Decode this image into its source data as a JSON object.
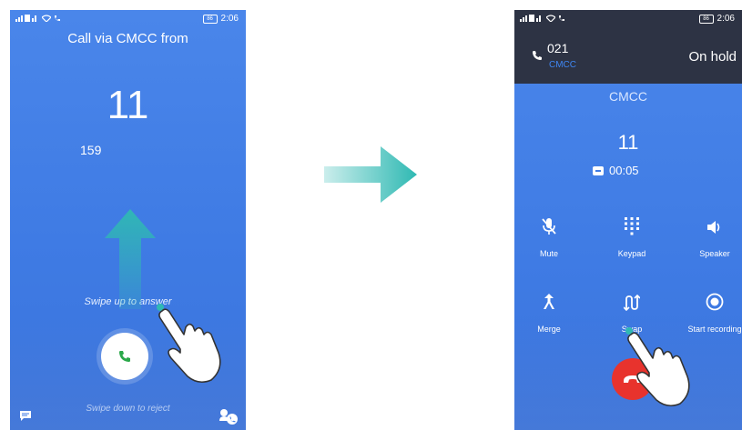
{
  "incoming_screen": {
    "status_time": "2:06",
    "battery": "86",
    "call_via": "Call via CMCC from",
    "number_big": "11",
    "number_small": "159",
    "swipe_up_hint": "Swipe up to answer",
    "swipe_down_hint": "Swipe down to reject"
  },
  "in_call_screen": {
    "status_time": "2:06",
    "battery": "86",
    "hold_number": "021",
    "hold_name": "CMCC",
    "hold_status": "On hold",
    "caller_name": "CMCC",
    "number": "11",
    "duration": "00:05",
    "controls": {
      "mute": "Mute",
      "keypad": "Keypad",
      "speaker": "Speaker",
      "merge": "Merge",
      "swap": "Swap",
      "record": "Start recording"
    }
  },
  "colors": {
    "screen_blue": "#4283e8",
    "teal_arrow": "#2fb9b3",
    "end_call_red": "#e8332d",
    "answer_green": "#2ba84a",
    "hold_bar": "#2d3344"
  }
}
